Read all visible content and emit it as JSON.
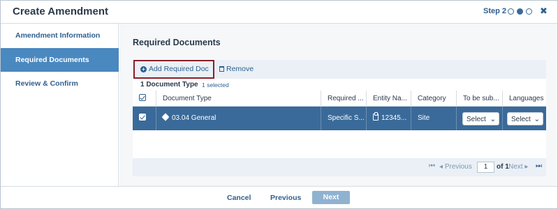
{
  "modal": {
    "title": "Create Amendment",
    "step_label": "Step 2",
    "close_glyph": "✖"
  },
  "sidebar": {
    "items": [
      {
        "label": "Amendment Information"
      },
      {
        "label": "Required Documents"
      },
      {
        "label": "Review & Confirm"
      }
    ]
  },
  "main": {
    "section_title": "Required Documents",
    "toolbar": {
      "add_label": "Add Required Doc",
      "remove_label": "Remove"
    },
    "count_label": "1 Document Type",
    "selected_label": "1 selected",
    "columns": [
      "Document Type",
      "Required ...",
      "Entity Na...",
      "Category",
      "To be sub...",
      "Languages"
    ],
    "rows": [
      {
        "document_type": "03.04 General",
        "required": "Specific S...",
        "entity": "12345...",
        "category": "Site",
        "to_be_submitted": "Select",
        "languages": "Select"
      }
    ],
    "pager": {
      "previous_label": "Previous",
      "page_value": "1",
      "of_label": "of 1",
      "next_label": "Next"
    }
  },
  "footer": {
    "cancel_label": "Cancel",
    "previous_label": "Previous",
    "next_label": "Next"
  }
}
